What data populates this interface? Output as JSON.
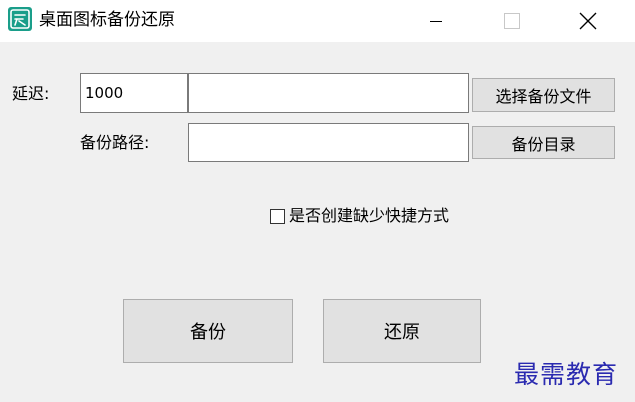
{
  "window": {
    "title": "桌面图标备份还原",
    "icon": "app-logo-icon",
    "controls": {
      "minimize": "minimize-icon",
      "maximize": "maximize-icon",
      "close": "close-icon"
    }
  },
  "form": {
    "delay_label": "延迟:",
    "delay_value": "1000",
    "backup_file_value": "",
    "select_file_button": "选择备份文件",
    "backup_path_label": "备份路径:",
    "backup_path_value": "",
    "backup_dir_button": "备份目录",
    "create_missing_shortcuts_label": "是否创建缺少快捷方式",
    "create_missing_shortcuts_checked": false
  },
  "actions": {
    "backup_button": "备份",
    "restore_button": "还原"
  },
  "watermark": "最需教育",
  "colors": {
    "window_bg": "#f0f0f0",
    "titlebar_bg": "#ffffff",
    "button_bg": "#e1e1e1",
    "watermark": "#2a2ab0",
    "app_icon": "#1a9e8a"
  }
}
